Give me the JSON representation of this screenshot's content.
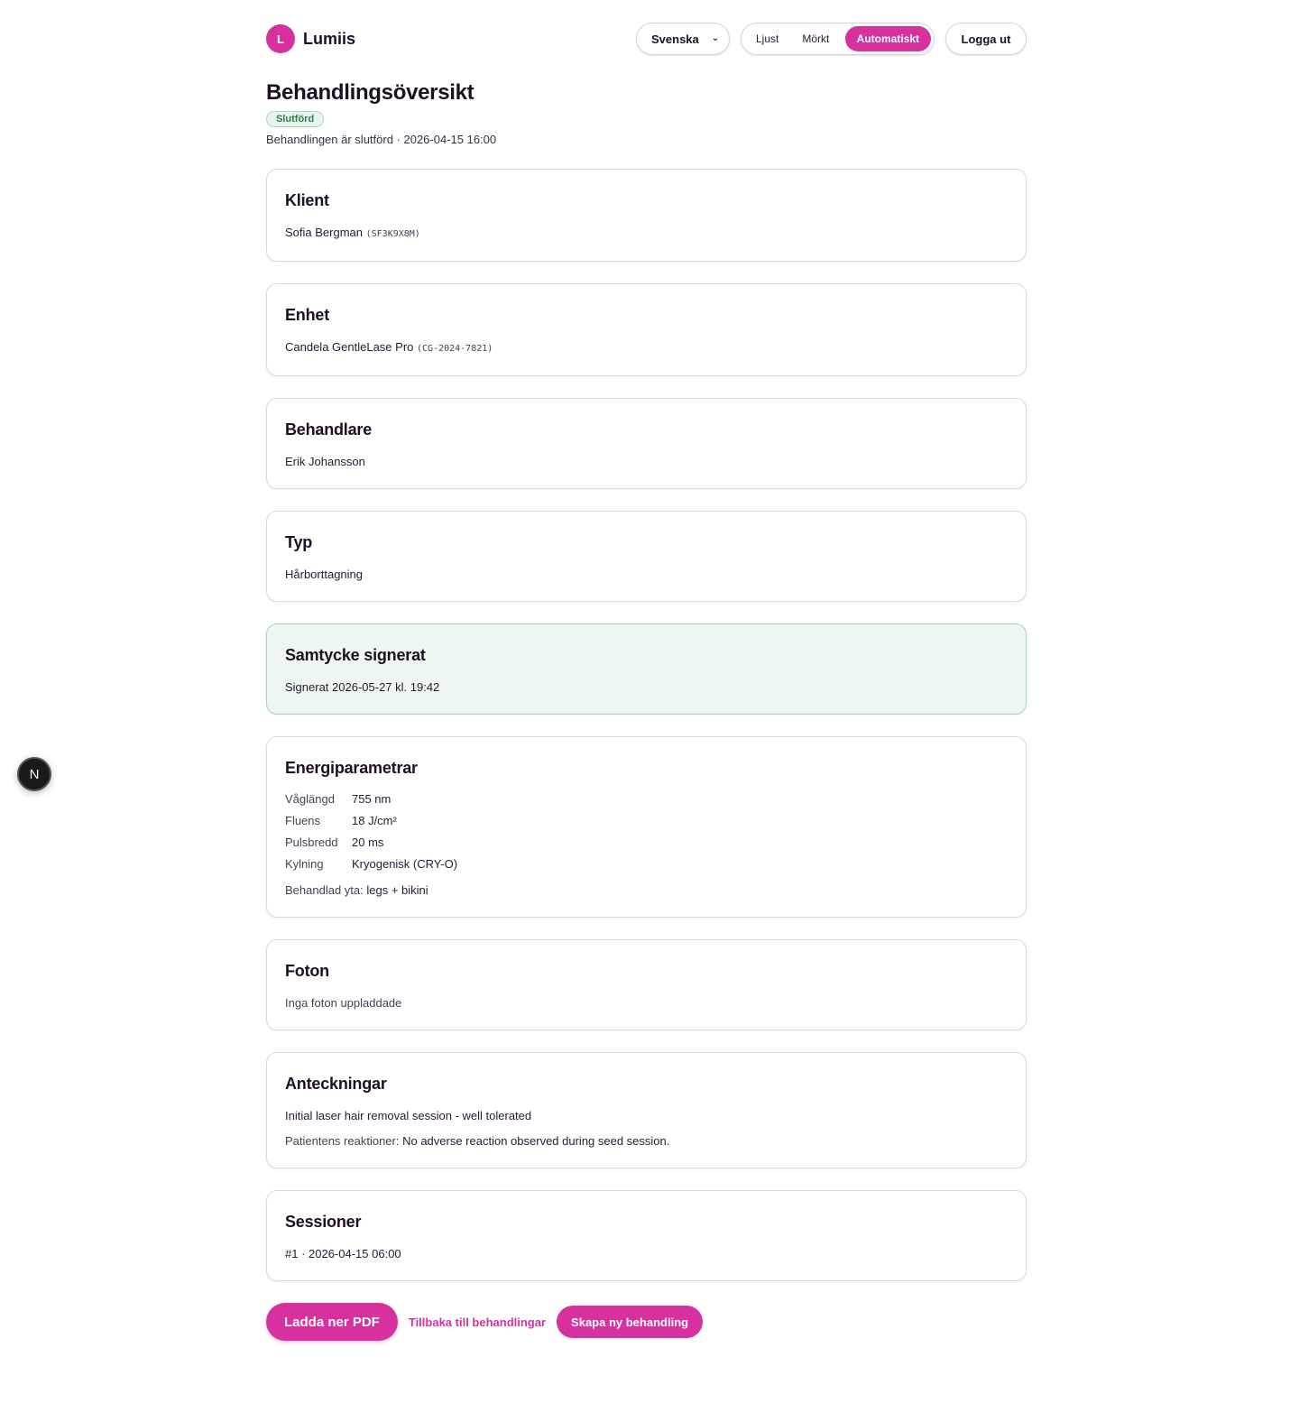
{
  "header": {
    "brand_initial": "L",
    "brand_name": "Lumiis",
    "language": "Svenska",
    "theme_options": [
      "Ljust",
      "Mörkt",
      "Automatiskt"
    ],
    "theme_selected": "Automatiskt",
    "logout_label": "Logga ut"
  },
  "page": {
    "title": "Behandlingsöversikt",
    "status_badge": "Slutförd",
    "status_line": "Behandlingen är slutförd · 2026-04-15 16:00"
  },
  "cards": {
    "client": {
      "title": "Klient",
      "name": "Sofia Bergman",
      "code": "(SF3K9X8M)"
    },
    "device": {
      "title": "Enhet",
      "name": "Candela GentleLase Pro",
      "code": "(CG-2024-7821)"
    },
    "practitioner": {
      "title": "Behandlare",
      "name": "Erik Johansson"
    },
    "type": {
      "title": "Typ",
      "value": "Hårborttagning"
    },
    "consent": {
      "title": "Samtycke signerat",
      "text": "Signerat 2026-05-27 kl. 19:42"
    },
    "energy": {
      "title": "Energiparametrar",
      "params": [
        {
          "label": "Våglängd",
          "value": "755 nm"
        },
        {
          "label": "Fluens",
          "value": "18 J/cm²"
        },
        {
          "label": "Pulsbredd",
          "value": "20 ms"
        },
        {
          "label": "Kylning",
          "value": "Kryogenisk (CRY-O)"
        }
      ],
      "area_label": "Behandlad yta:",
      "area_value": "legs + bikini"
    },
    "photos": {
      "title": "Foton",
      "text": "Inga foton uppladdade"
    },
    "notes": {
      "title": "Anteckningar",
      "note": "Initial laser hair removal session - well tolerated",
      "reactions_label": "Patientens reaktioner:",
      "reactions_value": "No adverse reaction observed during seed session."
    },
    "sessions": {
      "title": "Sessioner",
      "items": [
        "#1 · 2026-04-15 06:00"
      ]
    }
  },
  "actions": {
    "download_pdf": "Ladda ner PDF",
    "back": "Tillbaka till behandlingar",
    "create_new": "Skapa ny behandling"
  },
  "dev_badge": "N",
  "colors": {
    "accent": "#d6319e",
    "success": "#2e7d4c",
    "consent_bg": "#edf6f0"
  }
}
